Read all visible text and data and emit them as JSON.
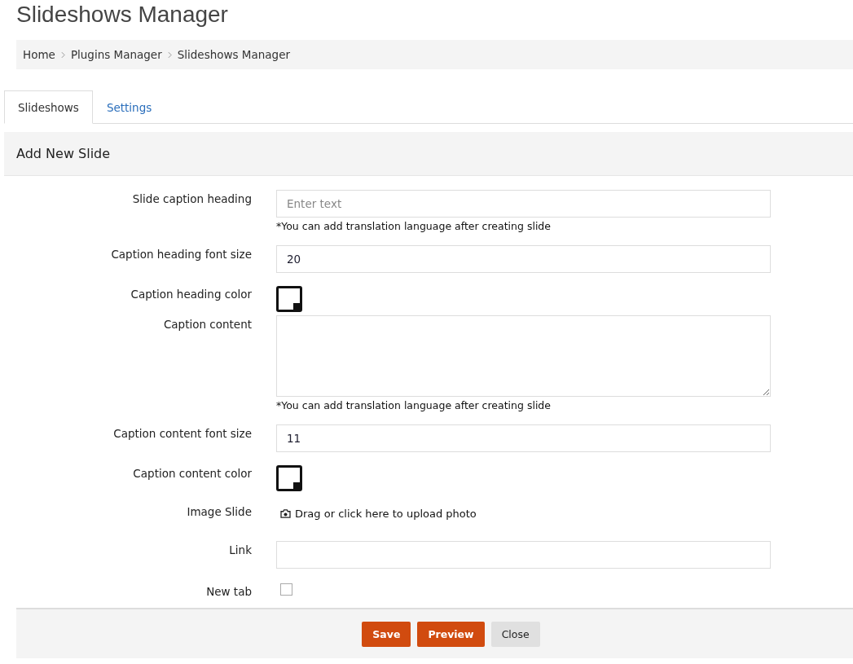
{
  "page_title": "Slideshows Manager",
  "breadcrumb": [
    "Home",
    "Plugins Manager",
    "Slideshows Manager"
  ],
  "tabs": [
    {
      "label": "Slideshows",
      "selected": true
    },
    {
      "label": "Settings",
      "selected": false
    }
  ],
  "panel": {
    "title": "Add New Slide",
    "fields": [
      {
        "kind": "text",
        "label": "Slide caption heading",
        "placeholder": "Enter text",
        "hint": "*You can add translation language after creating slide"
      },
      {
        "kind": "text",
        "label": "Caption heading font size",
        "value": "20"
      },
      {
        "kind": "color",
        "label": "Caption heading color"
      },
      {
        "kind": "textarea",
        "label": "Caption content",
        "hint": "*You can add translation language after creating slide"
      },
      {
        "kind": "text",
        "label": "Caption content font size",
        "value": "11"
      },
      {
        "kind": "color",
        "label": "Caption content color"
      },
      {
        "kind": "upload",
        "label": "Image Slide",
        "text": "Drag or click here to upload photo"
      },
      {
        "kind": "text",
        "label": "Link"
      },
      {
        "kind": "checkbox",
        "label": "New tab",
        "checked": false
      }
    ],
    "buttons": [
      {
        "label": "Save",
        "kind": "primary"
      },
      {
        "label": "Preview",
        "kind": "primary"
      },
      {
        "label": "Close",
        "kind": "default"
      }
    ]
  }
}
